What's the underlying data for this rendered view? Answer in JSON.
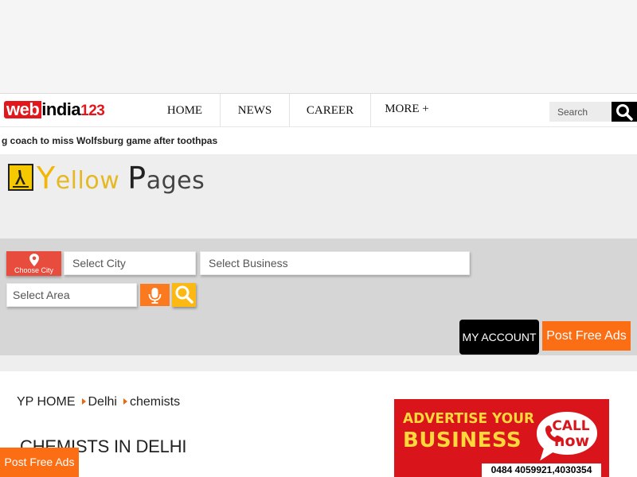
{
  "nav": {
    "logo": {
      "web": "web",
      "india": "india",
      "num": "123"
    },
    "items": [
      {
        "label": "HOME"
      },
      {
        "label": "NEWS"
      },
      {
        "label": "CAREER"
      },
      {
        "label": "MORE +"
      }
    ],
    "search_placeholder": "Search"
  },
  "ticker": {
    "text": "g coach to miss Wolfsburg game after toothpas"
  },
  "yellow_pages": {
    "y": "Y",
    "ellow": "ellow",
    "p": "P",
    "ages": "ages"
  },
  "search_panel": {
    "choose_city": "Choose City",
    "city_placeholder": "Select City",
    "business_placeholder": "Select Business",
    "area_placeholder": "Select Area",
    "my_account": "MY ACCOUNT",
    "post_free_ads": "Post Free Ads"
  },
  "breadcrumb": [
    {
      "label": "YP HOME"
    },
    {
      "label": "Delhi"
    },
    {
      "label": "chemists"
    }
  ],
  "page_title": "CHEMISTS IN DELHI",
  "ad": {
    "line1": "ADVERTISE YOUR",
    "line2": "BUSINESS",
    "call": "CALL",
    "now": "now",
    "phone": "0484 4059921,4030354"
  },
  "floating_post": "Post Free Ads",
  "colors": {
    "brand_red": "#e3161c",
    "orange": "#fb6e14",
    "yellow": "#fdb913",
    "panel_gray": "#d6d6d6"
  }
}
